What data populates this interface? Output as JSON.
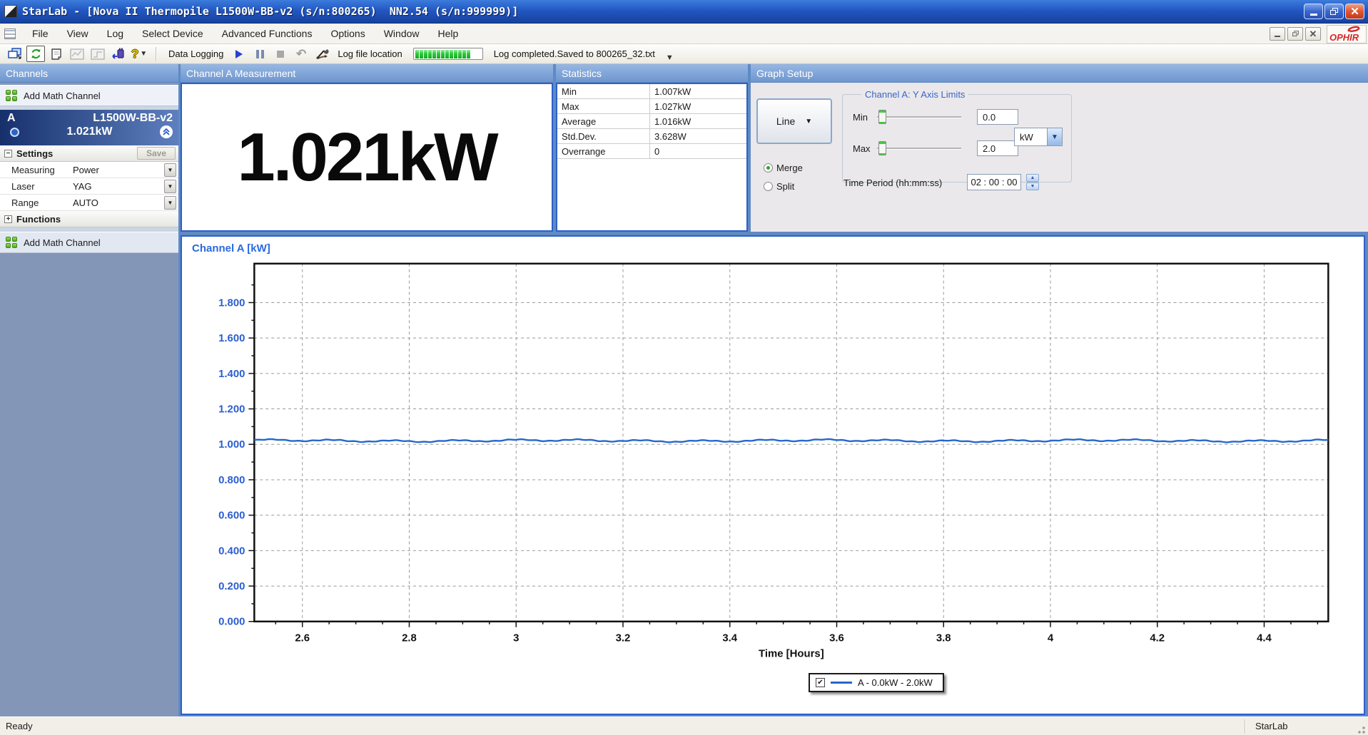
{
  "window": {
    "title": "StarLab - [Nova II Thermopile L1500W-BB-v2 (s/n:800265)  NN2.54 (s/n:999999)]",
    "status_left": "Ready",
    "status_right": "StarLab"
  },
  "menu": {
    "items": [
      "File",
      "View",
      "Log",
      "Select Device",
      "Advanced Functions",
      "Options",
      "Window",
      "Help"
    ]
  },
  "toolbar": {
    "data_logging_label": "Data Logging",
    "log_file_location_label": "Log file location",
    "log_status": "Log completed.Saved to 800265_32.txt",
    "progress_segments": 13
  },
  "channels": {
    "header": "Channels",
    "add_math_channel": "Add Math Channel",
    "add_math_channel_2": "Add Math Channel",
    "channel": {
      "id": "A",
      "name": "L1500W-BB-v2",
      "value": "1.021kW"
    },
    "settings": {
      "label": "Settings",
      "save_label": "Save",
      "rows": [
        {
          "label": "Measuring",
          "value": "Power"
        },
        {
          "label": "Laser",
          "value": "YAG"
        },
        {
          "label": "Range",
          "value": "AUTO"
        }
      ]
    },
    "functions_label": "Functions"
  },
  "measurement": {
    "header": "Channel A Measurement",
    "value": "1.021kW"
  },
  "statistics": {
    "header": "Statistics",
    "rows": [
      {
        "label": "Min",
        "value": "1.007kW"
      },
      {
        "label": "Max",
        "value": "1.027kW"
      },
      {
        "label": "Average",
        "value": "1.016kW"
      },
      {
        "label": "Std.Dev.",
        "value": "3.628W"
      },
      {
        "label": "Overrange",
        "value": "0"
      }
    ]
  },
  "graph_setup": {
    "header": "Graph Setup",
    "line_combo_value": "Line",
    "merge_label": "Merge",
    "split_label": "Split",
    "y_axis_group_label": "Channel A: Y Axis Limits",
    "min_label": "Min",
    "max_label": "Max",
    "min_value": "0.0",
    "max_value": "2.0",
    "unit_value": "kW",
    "time_period_label": "Time Period (hh:mm:ss)",
    "time_period_value": "02 : 00 : 00"
  },
  "legend": {
    "checked": true,
    "series_label": "A - 0.0kW - 2.0kW"
  },
  "chart_data": {
    "type": "line",
    "title": "Channel A [kW]",
    "xlabel": "Time [Hours]",
    "xlim": [
      2.51,
      4.52
    ],
    "ylim": [
      0,
      2.02
    ],
    "x_major_ticks": [
      2.6,
      2.8,
      3.0,
      3.2,
      3.4,
      3.6,
      3.8,
      4.0,
      4.2,
      4.4
    ],
    "x_tick_labels": [
      "2.6",
      "2.8",
      "3",
      "3.2",
      "3.4",
      "3.6",
      "3.8",
      "4",
      "4.2",
      "4.4"
    ],
    "x_minor_step": 0.05,
    "y_tick_labels": [
      "1.800",
      "1.600",
      "1.400",
      "1.200",
      "1.000",
      "0.800",
      "0.600",
      "0.400",
      "0.200",
      "0.000"
    ],
    "y_major_step": 0.2,
    "y_minor_step": 0.1,
    "grid": "dashed",
    "legend_position": "bottom-center",
    "series": [
      {
        "name": "A - 0.0kW - 2.0kW",
        "color": "#2468cc",
        "average_kW": 1.016,
        "min_kW": 1.007,
        "max_kW": 1.027,
        "shape": "nearly flat noisy line at ~1.02 kW spanning the full x range"
      }
    ]
  },
  "colors": {
    "titlebar_blue": "#2258c2",
    "panel_header_blue": "#7aa2d6",
    "desktop_blue": "#5f8ac4",
    "sidebar_blue_gray": "#8496b8",
    "focus_border_blue": "#2e60c8",
    "series_blue": "#2468cc",
    "axis_label_blue": "#2b5ed1",
    "progress_green": "#2dc83a",
    "ophir_red": "#d42828"
  }
}
